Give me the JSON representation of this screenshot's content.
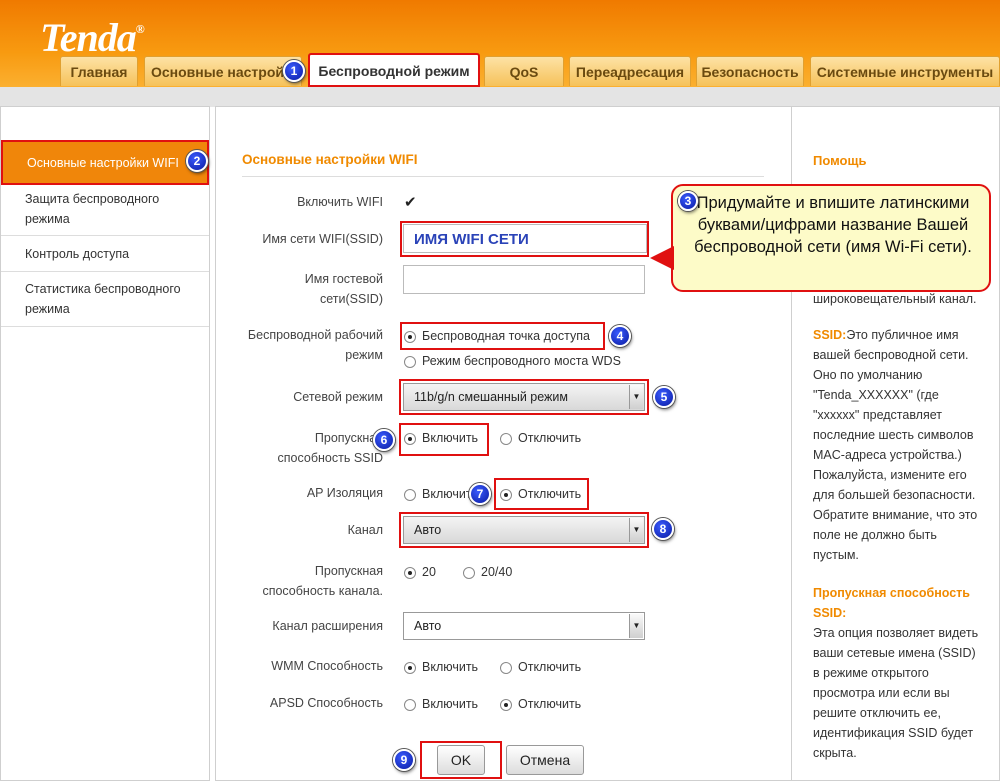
{
  "header": {
    "logo": "Tenda",
    "logo_mark": "®",
    "tabs": [
      "Главная",
      "Основные настрой",
      "Беспроводной режим",
      "QoS",
      "Переадресация",
      "Безопасность",
      "Системные инструменты"
    ]
  },
  "sidebar": {
    "items": [
      "Основные настройки WIFI",
      "Защита беспроводного режима",
      "Контроль доступа",
      "Статистика беспроводного режима"
    ]
  },
  "form": {
    "title": "Основные настройки WIFI",
    "enable_wifi_label": "Включить WIFI",
    "enable_wifi_checked": true,
    "ssid_label": "Имя сети WIFI(SSID)",
    "ssid_value": "ИМЯ WIFI СЕТИ",
    "guest_label": "Имя гостевой сети(SSID)",
    "guest_value": "",
    "mode_label": "Беспроводной рабочий режим",
    "mode_options": [
      "Беспроводная точка доступа",
      "Режим беспроводного моста WDS"
    ],
    "net_mode_label": "Сетевой режим",
    "net_mode_value": "11b/g/n смешанный режим",
    "ssid_broadcast_label": "Пропускная способность SSID",
    "ap_isolation_label": "AP Изоляция",
    "channel_label": "Канал",
    "channel_value": "Авто",
    "bandwidth_label": "Пропускная способность канала.",
    "bandwidth_options": [
      "20",
      "20/40"
    ],
    "ext_channel_label": "Канал расширения",
    "ext_channel_value": "Авто",
    "wmm_label": "WMM Способность",
    "apsd_label": "APSD Способность",
    "on": "Включить",
    "off": "Отключить",
    "ok": "OK",
    "cancel": "Отмена"
  },
  "help": {
    "title": "Помощь",
    "broadcast_tail": "широковещательный канал.",
    "ssid_term": "SSID:",
    "ssid_text": "Это публичное имя вашей беспроводной сети. Оно по умолчанию \"Tenda_XXXXXX\" (где \"xxxxxx\" представляет последние шесть символов MAC-адреса устройства.) Пожалуйста, измените его для большей безопасности. Обратите внимание, что это поле не должно быть пустым.",
    "bw_title": "Пропускная способность SSID:",
    "bw_text": "Эта опция позволяет видеть ваши сетевые имена (SSID) в режиме открытого просмотра или если вы решите отключить ее, идентификация SSID будет скрыта."
  },
  "annotations": {
    "callout": "Придумайте и впишите латинскими буквами/цифрами название Вашей беспроводной сети (имя Wi-Fi сети).",
    "badges": [
      "1",
      "2",
      "3",
      "4",
      "5",
      "6",
      "7",
      "8",
      "9"
    ]
  }
}
